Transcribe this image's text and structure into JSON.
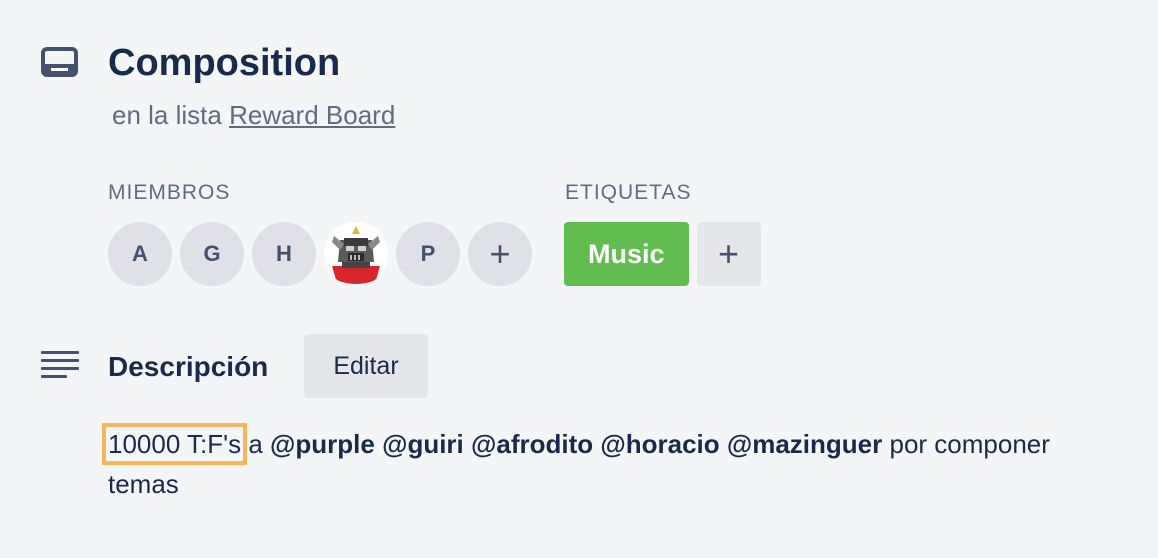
{
  "card": {
    "title": "Composition",
    "in_list_prefix": "en la lista",
    "list_name": "Reward Board"
  },
  "members": {
    "label": "MIEMBROS",
    "avatars": [
      {
        "initial": "A"
      },
      {
        "initial": "G"
      },
      {
        "initial": "H"
      },
      {
        "initial": ""
      },
      {
        "initial": "P"
      }
    ],
    "add_label": "+"
  },
  "labels": {
    "label": "ETIQUETAS",
    "items": [
      {
        "text": "Music",
        "color": "#61bd4f"
      }
    ],
    "add_label": "+"
  },
  "description": {
    "title": "Descripción",
    "edit_label": "Editar",
    "highlight_text": "10000 T:F's",
    "text_a": " a ",
    "mentions": [
      "@purple",
      "@guiri",
      "@afrodito",
      "@horacio",
      "@mazinguer"
    ],
    "text_tail": " por componer temas"
  },
  "icons": {
    "card": "card-icon",
    "description": "description-icon"
  }
}
